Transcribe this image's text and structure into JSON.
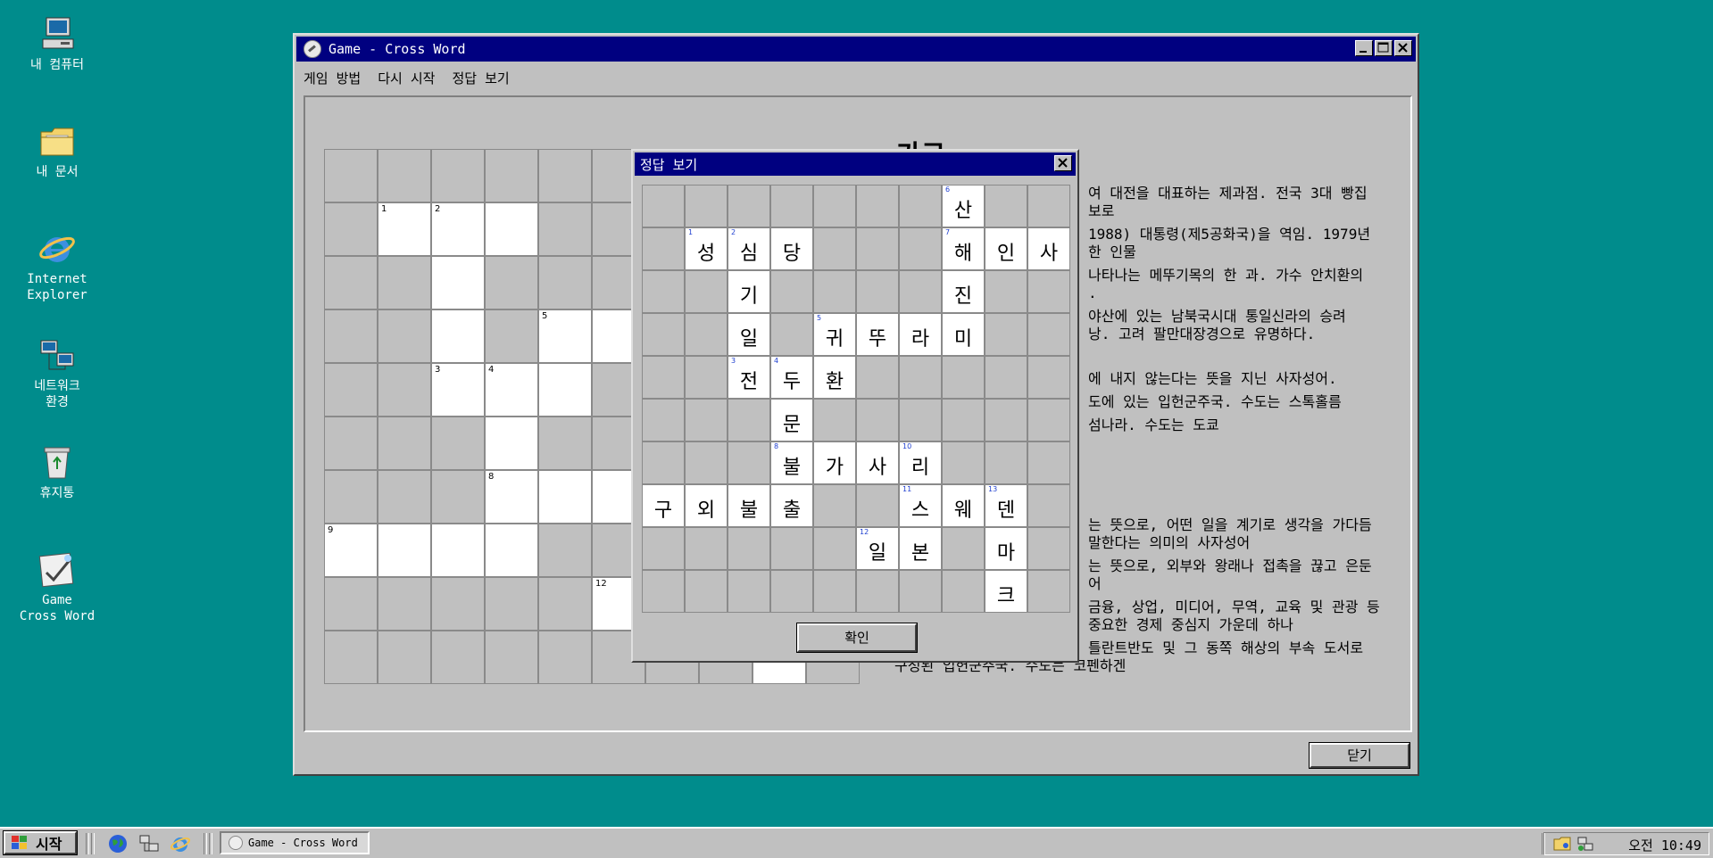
{
  "desktop": {
    "icons": [
      {
        "label_line1": "내 컴퓨터",
        "label_line2": "",
        "icon": "my-computer-icon"
      },
      {
        "label_line1": "내 문서",
        "label_line2": "",
        "icon": "my-documents-icon"
      },
      {
        "label_line1": "Internet",
        "label_line2": "Explorer",
        "icon": "internet-explorer-icon"
      },
      {
        "label_line1": "네트워크",
        "label_line2": "환경",
        "icon": "network-icon"
      },
      {
        "label_line1": "휴지통",
        "label_line2": "",
        "icon": "recycle-bin-icon"
      },
      {
        "label_line1": "Game",
        "label_line2": "Cross Word",
        "icon": "game-crossword-icon"
      }
    ]
  },
  "main_window": {
    "title": "Game - Cross Word",
    "menu": [
      "게임 방법",
      "다시 시작",
      "정답 보기"
    ],
    "close_button_label": "닫기",
    "clue_heading": "가로",
    "clue_lines": [
      "여 대전을 대표하는 제과점. 전국 3대 빵집",
      "보로",
      "1988) 대통령(제5공화국)을 역임. 1979년",
      "한 인물",
      "나타나는 메뚜기목의 한 과. 가수 안치환의",
      ".",
      "야산에 있는 남북국시대 통일신라의 승려",
      "낭. 고려 팔만대장경으로 유명하다.",
      "에 내지 않는다는 뜻을 지닌 사자성어.",
      "도에 있는 입헌군주국. 수도는 스톡홀름",
      "섬나라. 수도는 도쿄",
      "는 뜻으로, 어떤 일을 계기로 생각을 가다듬",
      "말한다는 의미의 사자성어",
      "는 뜻으로, 외부와 왕래나 접촉을 끊고 은둔",
      "어",
      "금융, 상업, 미디어, 무역, 교육 및 관광 등",
      "중요한 경제 중심지 가운데 하나",
      "틀란트반도 및 그 동쪽 해상의 부속 도서로",
      "구성된 입헌군주국. 수도는 코펜하겐"
    ]
  },
  "answer_dialog": {
    "title": "정답 보기",
    "ok_label": "확인",
    "cells": [
      {
        "r": 0,
        "c": 7,
        "ch": "산",
        "num": "6"
      },
      {
        "r": 1,
        "c": 1,
        "ch": "성",
        "num": "1"
      },
      {
        "r": 1,
        "c": 2,
        "ch": "심",
        "num": "2"
      },
      {
        "r": 1,
        "c": 3,
        "ch": "당",
        "num": ""
      },
      {
        "r": 1,
        "c": 7,
        "ch": "해",
        "num": "7"
      },
      {
        "r": 1,
        "c": 8,
        "ch": "인",
        "num": ""
      },
      {
        "r": 1,
        "c": 9,
        "ch": "사",
        "num": ""
      },
      {
        "r": 2,
        "c": 2,
        "ch": "기",
        "num": ""
      },
      {
        "r": 2,
        "c": 7,
        "ch": "진",
        "num": ""
      },
      {
        "r": 3,
        "c": 2,
        "ch": "일",
        "num": ""
      },
      {
        "r": 3,
        "c": 4,
        "ch": "귀",
        "num": "5"
      },
      {
        "r": 3,
        "c": 5,
        "ch": "뚜",
        "num": ""
      },
      {
        "r": 3,
        "c": 6,
        "ch": "라",
        "num": ""
      },
      {
        "r": 3,
        "c": 7,
        "ch": "미",
        "num": ""
      },
      {
        "r": 4,
        "c": 2,
        "ch": "전",
        "num": "3"
      },
      {
        "r": 4,
        "c": 3,
        "ch": "두",
        "num": "4"
      },
      {
        "r": 4,
        "c": 4,
        "ch": "환",
        "num": ""
      },
      {
        "r": 5,
        "c": 3,
        "ch": "문",
        "num": ""
      },
      {
        "r": 6,
        "c": 3,
        "ch": "불",
        "num": "8"
      },
      {
        "r": 6,
        "c": 4,
        "ch": "가",
        "num": ""
      },
      {
        "r": 6,
        "c": 5,
        "ch": "사",
        "num": ""
      },
      {
        "r": 6,
        "c": 6,
        "ch": "리",
        "num": "10"
      },
      {
        "r": 7,
        "c": 0,
        "ch": "구",
        "num": ""
      },
      {
        "r": 7,
        "c": 1,
        "ch": "외",
        "num": ""
      },
      {
        "r": 7,
        "c": 2,
        "ch": "불",
        "num": ""
      },
      {
        "r": 7,
        "c": 3,
        "ch": "출",
        "num": ""
      },
      {
        "r": 7,
        "c": 6,
        "ch": "스",
        "num": "11"
      },
      {
        "r": 7,
        "c": 7,
        "ch": "웨",
        "num": ""
      },
      {
        "r": 7,
        "c": 8,
        "ch": "덴",
        "num": "13"
      },
      {
        "r": 8,
        "c": 5,
        "ch": "일",
        "num": "12"
      },
      {
        "r": 8,
        "c": 6,
        "ch": "본",
        "num": ""
      },
      {
        "r": 8,
        "c": 8,
        "ch": "마",
        "num": ""
      },
      {
        "r": 9,
        "c": 8,
        "ch": "크",
        "num": ""
      }
    ]
  },
  "puzzle": {
    "cells": [
      {
        "r": 1,
        "c": 1,
        "num": "1"
      },
      {
        "r": 1,
        "c": 2,
        "num": "2"
      },
      {
        "r": 1,
        "c": 3,
        "num": ""
      },
      {
        "r": 2,
        "c": 2,
        "num": ""
      },
      {
        "r": 3,
        "c": 2,
        "num": ""
      },
      {
        "r": 3,
        "c": 4,
        "num": "5"
      },
      {
        "r": 3,
        "c": 5,
        "num": ""
      },
      {
        "r": 4,
        "c": 2,
        "num": "3"
      },
      {
        "r": 4,
        "c": 3,
        "num": "4"
      },
      {
        "r": 4,
        "c": 4,
        "num": ""
      },
      {
        "r": 5,
        "c": 3,
        "num": ""
      },
      {
        "r": 6,
        "c": 3,
        "num": "8"
      },
      {
        "r": 6,
        "c": 4,
        "num": ""
      },
      {
        "r": 6,
        "c": 5,
        "num": ""
      },
      {
        "r": 7,
        "c": 0,
        "num": "9"
      },
      {
        "r": 7,
        "c": 1,
        "num": ""
      },
      {
        "r": 7,
        "c": 2,
        "num": ""
      },
      {
        "r": 7,
        "c": 3,
        "num": ""
      },
      {
        "r": 8,
        "c": 5,
        "num": "12"
      },
      {
        "r": 9,
        "c": 8,
        "num": ""
      }
    ]
  },
  "taskbar": {
    "start_label": "시작",
    "quicklaunch": [
      "globe-icon",
      "network-tools-icon",
      "internet-explorer-icon"
    ],
    "task_label": "Game - Cross Word",
    "clock": "오전 10:49"
  }
}
